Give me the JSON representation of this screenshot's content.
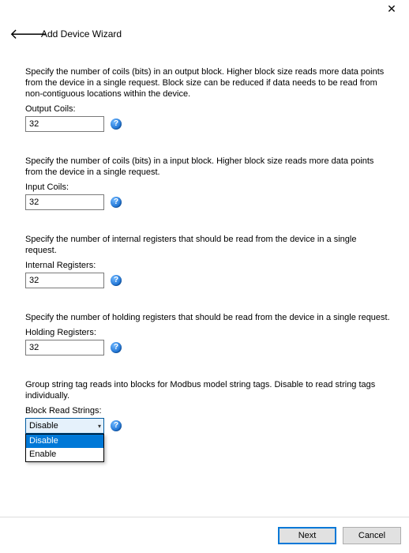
{
  "window": {
    "title": "Add Device Wizard"
  },
  "fields": {
    "output_coils": {
      "desc": "Specify the number of coils (bits) in an output block. Higher block size reads more data points from the device in a single request. Block size can be reduced if data needs to be read from non-contiguous locations within the device.",
      "label": "Output Coils:",
      "value": "32"
    },
    "input_coils": {
      "desc": "Specify the number of coils (bits) in a input block. Higher block size reads more data points from the device in a single request.",
      "label": "Input Coils:",
      "value": "32"
    },
    "internal_registers": {
      "desc": "Specify the number of internal registers that should be read from the device in a single request.",
      "label": "Internal Registers:",
      "value": "32"
    },
    "holding_registers": {
      "desc": "Specify the number of holding registers that should be read from the device in a single request.",
      "label": "Holding Registers:",
      "value": "32"
    },
    "block_read_strings": {
      "desc": "Group string tag reads into blocks for Modbus model string tags. Disable to read string tags individually.",
      "label": "Block Read Strings:",
      "selected": "Disable",
      "options": [
        "Disable",
        "Enable"
      ]
    }
  },
  "footer": {
    "next": "Next",
    "cancel": "Cancel"
  },
  "icons": {
    "help": "?"
  }
}
